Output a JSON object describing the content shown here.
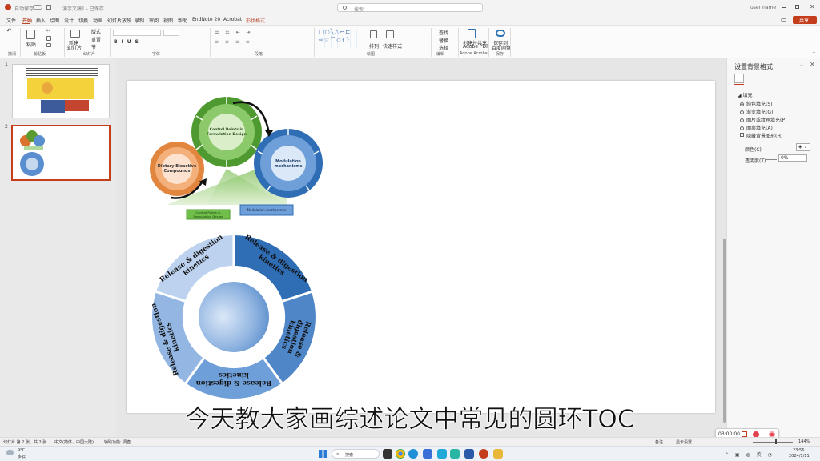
{
  "titlebar": {
    "autosave": "自动保存",
    "doc_title": "演示文稿1 - 已保存",
    "search_placeholder": "搜索",
    "user": "user name",
    "share_label": "共享"
  },
  "menu": [
    "文件",
    "开始",
    "插入",
    "绘图",
    "设计",
    "切换",
    "动画",
    "幻灯片放映",
    "录制",
    "审阅",
    "视图",
    "帮助",
    "EndNote 20",
    "Acrobat",
    "形状格式"
  ],
  "ribbon": {
    "groups": [
      "剪贴板",
      "幻灯片",
      "字体",
      "段落",
      "绘图",
      "编辑",
      "Adobe Acrobat",
      "保存"
    ],
    "paste": "粘贴",
    "new_slide": "新建\n幻灯片",
    "reuse": "重用\n幻灯片",
    "layout": "版式",
    "reset": "重置",
    "section": "节",
    "font_placeholder": "",
    "arrange": "排列",
    "quick_styles": "快速样式",
    "find": "查找",
    "replace": "替换",
    "select": "选择",
    "create_pdf": "创建并共享\nAdobe PDF",
    "save_to": "保存到\n百度网盘"
  },
  "thumbnails": [
    {
      "num": "1"
    },
    {
      "num": "2"
    }
  ],
  "slide": {
    "outer_ring_labels": [
      "Release & digestion kinetics",
      "Release & digestion kinetics",
      "Release & digestion kinetics",
      "Release & digestion kinetics",
      "Release & digestion kinetics"
    ],
    "top": {
      "orange_center": "Dietary Bioactive Compounds",
      "green_center": "Control Points in Formulation Design",
      "blue_center": "Modulation mechanisms",
      "green_label": "Control Points in Formulation Design",
      "blue_label": "Modulation mechanisms"
    }
  },
  "pane": {
    "title": "设置背景格式",
    "section": "填充",
    "options": [
      "纯色填充(S)",
      "渐变填充(G)",
      "图片或纹理填充(P)",
      "图案填充(A)"
    ],
    "hide_bg": "隐藏背景图形(H)",
    "color_label": "颜色(C)",
    "transparency_label": "透明度(T)",
    "transparency_value": "0%"
  },
  "statusbar": {
    "slide_info": "幻灯片 第 2 张，共 2 张",
    "language": "中文(简体，中国大陆)",
    "accessibility": "辅助功能: 调查",
    "notes": "备注",
    "display": "显示设置",
    "zoom": "144%"
  },
  "recorder": {
    "time": "03:00:00"
  },
  "taskbar": {
    "weather_temp": "9°C",
    "weather_desc": "多云",
    "search": "搜索",
    "time": "23:56",
    "date": "2024/1/11"
  },
  "subtitle": "今天教大家画综述论文中常见的圆环TOC",
  "colors": {
    "accent_blue": "#2e74b5",
    "ring_dark": "#2f6db5",
    "ring_mid": "#5a8fcf",
    "ring_light": "#a9c4e8",
    "green": "#5a9a2e",
    "orange": "#d9732d",
    "pp_red": "#c43e1c"
  }
}
